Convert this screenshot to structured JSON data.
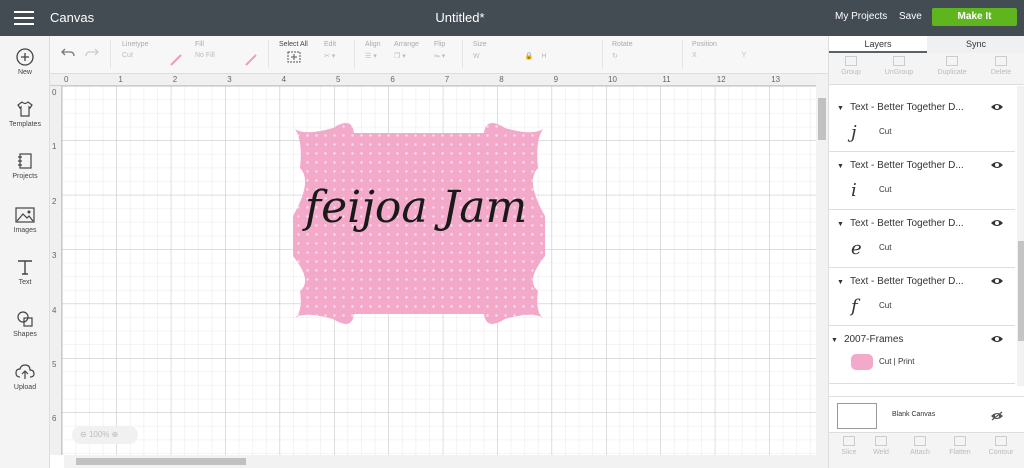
{
  "topbar": {
    "app_title": "Canvas",
    "doc_title": "Untitled*",
    "my_projects": "My Projects",
    "save": "Save",
    "make_it": "Make It"
  },
  "left_nav": [
    {
      "label": "New",
      "icon": "plus-circle-icon"
    },
    {
      "label": "Templates",
      "icon": "shirt-icon"
    },
    {
      "label": "Projects",
      "icon": "notebook-icon"
    },
    {
      "label": "Images",
      "icon": "image-icon"
    },
    {
      "label": "Text",
      "icon": "text-t-icon"
    },
    {
      "label": "Shapes",
      "icon": "shapes-icon"
    },
    {
      "label": "Upload",
      "icon": "upload-cloud-icon"
    }
  ],
  "toolbar": {
    "linetype_label": "Linetype",
    "linetype_value": "Cut",
    "fill_label": "Fill",
    "fill_value": "No Fill",
    "select_all": "Select All",
    "edit": "Edit",
    "align": "Align",
    "arrange": "Arrange",
    "flip": "Flip",
    "size": "Size",
    "size_w": "W",
    "size_h": "H",
    "rotate": "Rotate",
    "position": "Position",
    "pos_x": "X",
    "pos_y": "Y"
  },
  "ruler": {
    "top": [
      "0",
      "1",
      "2",
      "3",
      "4",
      "5",
      "6",
      "7",
      "8",
      "9",
      "10",
      "11",
      "12",
      "13"
    ],
    "left": [
      "0",
      "1",
      "2",
      "3",
      "4",
      "5",
      "6"
    ]
  },
  "canvas": {
    "zoom": "100%",
    "label_text": "feijoa Jam",
    "label_color": "#f2a9ca"
  },
  "panel": {
    "tabs": [
      "Layers",
      "Sync"
    ],
    "tools": [
      "Group",
      "UnGroup",
      "Duplicate",
      "Delete"
    ],
    "layers": [
      {
        "name": "Text - Better Together D...",
        "sub": "Cut",
        "glyph": "j"
      },
      {
        "name": "Text - Better Together D...",
        "sub": "Cut",
        "glyph": "i"
      },
      {
        "name": "Text - Better Together D...",
        "sub": "Cut",
        "glyph": "e"
      },
      {
        "name": "Text - Better Together D...",
        "sub": "Cut",
        "glyph": "f"
      },
      {
        "name": "2007-Frames",
        "sub": "Cut  |  Print",
        "glyph": ""
      }
    ],
    "blank_canvas": "Blank Canvas",
    "bottom_tools": [
      "Slice",
      "Weld",
      "Attach",
      "Flatten",
      "Contour"
    ]
  }
}
